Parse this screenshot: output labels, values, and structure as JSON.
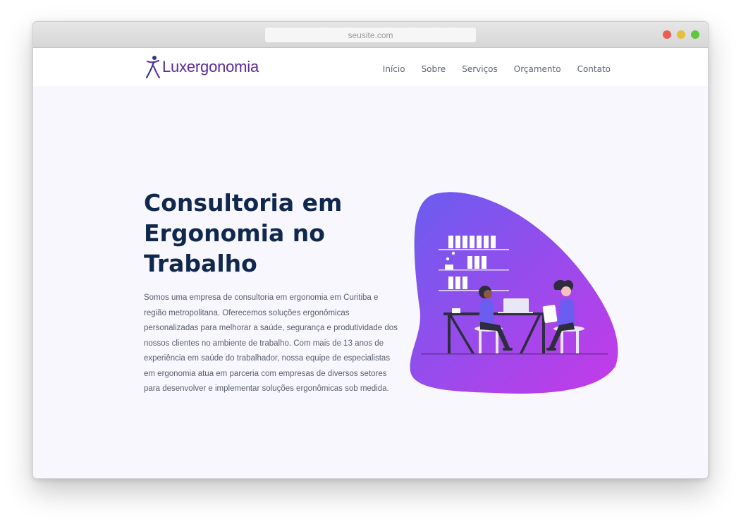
{
  "browser": {
    "url": "seusite.com"
  },
  "nav": {
    "logo_text": "Luxergonomia",
    "items": [
      "Início",
      "Sobre",
      "Serviços",
      "Orçamento",
      "Contato"
    ]
  },
  "hero": {
    "title": "Consultoria em Ergonomia no Trabalho",
    "description": "Somos uma empresa de consultoria em ergonomia em Curitiba e região metropolitana. Oferecemos soluções ergonômicas personalizadas para melhorar a saúde, segurança e produtividade dos nossos clientes no ambiente de trabalho. Com mais de 13 anos de experiência em saúde do trabalhador, nossa equipe de especialistas em ergonomia atua em parceria com empresas de diversos setores para desenvolver e implementar soluções ergonômicas sob medida."
  },
  "colors": {
    "title": "#11284e",
    "brand": "#5b2a98",
    "blob_start": "#6a5df0",
    "blob_end": "#c53ae8"
  },
  "icons": [
    "logo-figure-icon",
    "ergonomics-illustration"
  ]
}
